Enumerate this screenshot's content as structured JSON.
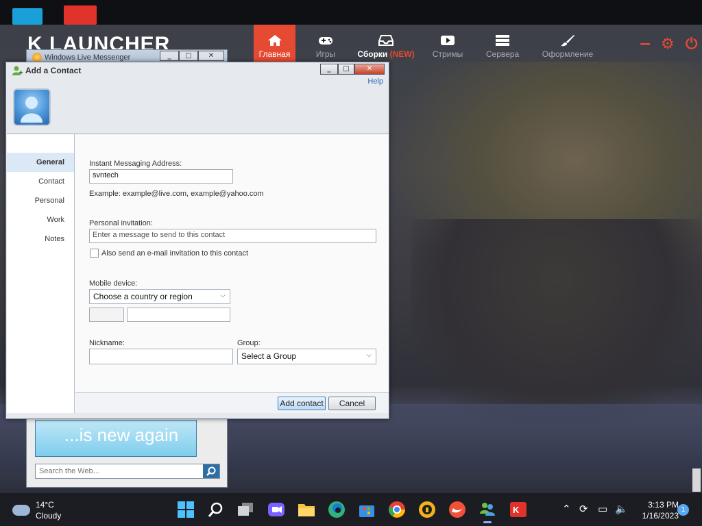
{
  "launcher": {
    "logo_text": "K LAUNCHER",
    "nav": [
      {
        "label": "Главная",
        "icon": "home-icon",
        "active": true
      },
      {
        "label": "Игры",
        "icon": "gamepad-icon",
        "active": false
      },
      {
        "label": "Сборки",
        "badge": "(NEW)",
        "icon": "inbox-icon",
        "active": false
      },
      {
        "label": "Стримы",
        "icon": "play-icon",
        "active": false
      },
      {
        "label": "Сервера",
        "icon": "server-icon",
        "active": false
      },
      {
        "label": "Оформление",
        "icon": "brush-icon",
        "active": false
      }
    ],
    "controls": {
      "minimize": "−",
      "settings": "⚙",
      "power": "⏻"
    },
    "accent_color": "#e64a32"
  },
  "messenger": {
    "title": "Windows Live Messenger",
    "window_buttons": [
      "_",
      "□",
      "✕"
    ],
    "promo_text": "...is new again",
    "web_search_placeholder": "Search the Web..."
  },
  "dialog": {
    "title": "Add a Contact",
    "window_buttons": [
      "_",
      "□",
      "✕"
    ],
    "help_link": "Help",
    "sidebar": [
      "General",
      "Contact",
      "Personal",
      "Work",
      "Notes"
    ],
    "selected_section": "General",
    "im_address": {
      "label": "Instant Messaging Address:",
      "value": "svntech",
      "example": "Example: example@live.com, example@yahoo.com"
    },
    "invitation": {
      "label": "Personal invitation:",
      "placeholder": "Enter a message to send to this contact",
      "email_checkbox_label": "Also send an e-mail invitation to this contact",
      "email_checked": false
    },
    "mobile": {
      "label": "Mobile device:",
      "country_select": "Choose a country or region",
      "code_value": "",
      "number_value": ""
    },
    "nickname": {
      "label": "Nickname:",
      "value": ""
    },
    "group": {
      "label": "Group:",
      "select": "Select a Group"
    },
    "buttons": {
      "add": "Add contact",
      "cancel": "Cancel"
    }
  },
  "taskbar": {
    "weather": {
      "temp": "14°C",
      "condition": "Cloudy"
    },
    "apps": [
      {
        "name": "windows-start-icon",
        "color": "#4cc2ff"
      },
      {
        "name": "search-icon",
        "color": "#ffffff"
      },
      {
        "name": "task-view-icon",
        "color": "#cfd3da"
      },
      {
        "name": "meet-icon",
        "color": "#7b61ff"
      },
      {
        "name": "file-explorer-icon",
        "color": "#f5c542"
      },
      {
        "name": "edge-icon",
        "color": "#2fb37a"
      },
      {
        "name": "store-icon",
        "color": "#3a8ee6"
      },
      {
        "name": "chrome-icon",
        "color": "#e94235"
      },
      {
        "name": "vpn-icon",
        "color": "#f3b11b"
      },
      {
        "name": "swift-icon",
        "color": "#f05138"
      },
      {
        "name": "messenger-icon",
        "color": "#6dbf4a",
        "active": true
      },
      {
        "name": "k-launcher-icon",
        "color": "#e0332c"
      }
    ],
    "time": "3:13 PM",
    "date": "1/16/2023",
    "notification_count": "1"
  }
}
